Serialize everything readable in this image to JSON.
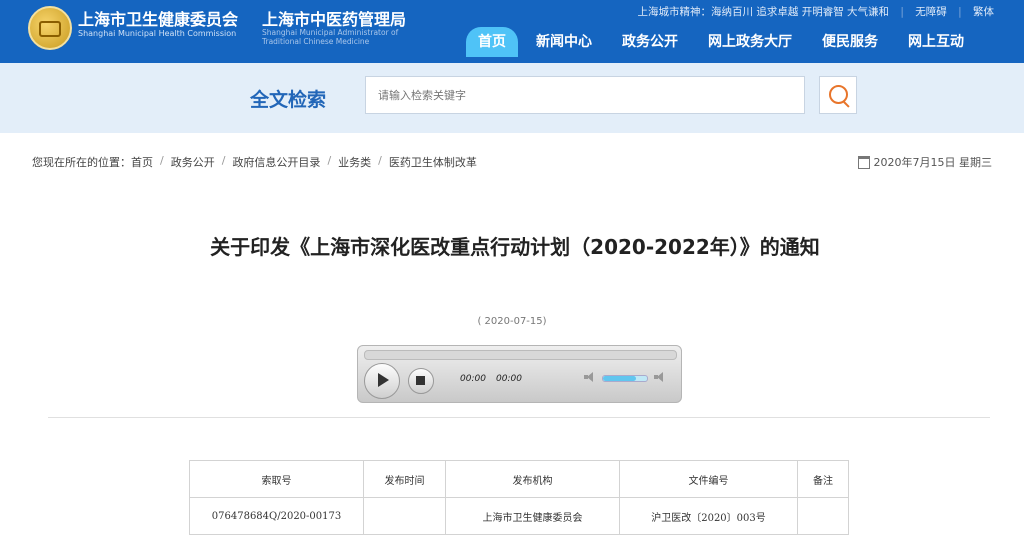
{
  "header": {
    "org1_name": "上海市卫生健康委员会",
    "org1_en": "Shanghai Municipal Health Commission",
    "org2_name": "上海市中医药管理局",
    "org2_en": "Shanghai Municipal Administrator of Traditional Chinese Medicine",
    "slogan": "上海城市精神：海纳百川 追求卓越 开明睿智 大气谦和",
    "accessibility": "无障碍",
    "traditional": "繁体",
    "nav": [
      "首页",
      "新闻中心",
      "政务公开",
      "网上政务大厅",
      "便民服务",
      "网上互动"
    ]
  },
  "search": {
    "title": "全文检索",
    "placeholder": "请输入检索关键字"
  },
  "breadcrumb": {
    "prefix": "您现在所在的位置：",
    "items": [
      "首页",
      "政务公开",
      "政府信息公开目录",
      "业务类",
      "医药卫生体制改革"
    ]
  },
  "date_line": "2020年7月15日 星期三",
  "article": {
    "title": "关于印发《上海市深化医改重点行动计划（2020-2022年）》的通知",
    "pub_date": "( 2020-07-15)"
  },
  "player": {
    "current_time": "00:00",
    "duration": "00:00",
    "volume": 0.75
  },
  "info_table": {
    "headers": [
      "索取号",
      "发布时间",
      "发布机构",
      "文件编号",
      "备注"
    ],
    "row": [
      "076478684Q/2020-00173",
      "",
      "上海市卫生健康委员会",
      "沪卫医改〔2020〕003号",
      ""
    ]
  },
  "colors": {
    "header_bg": "#1565c0",
    "nav_active": "#4fc3f7",
    "search_band": "#e3eef9",
    "search_accent": "#e8752b"
  }
}
